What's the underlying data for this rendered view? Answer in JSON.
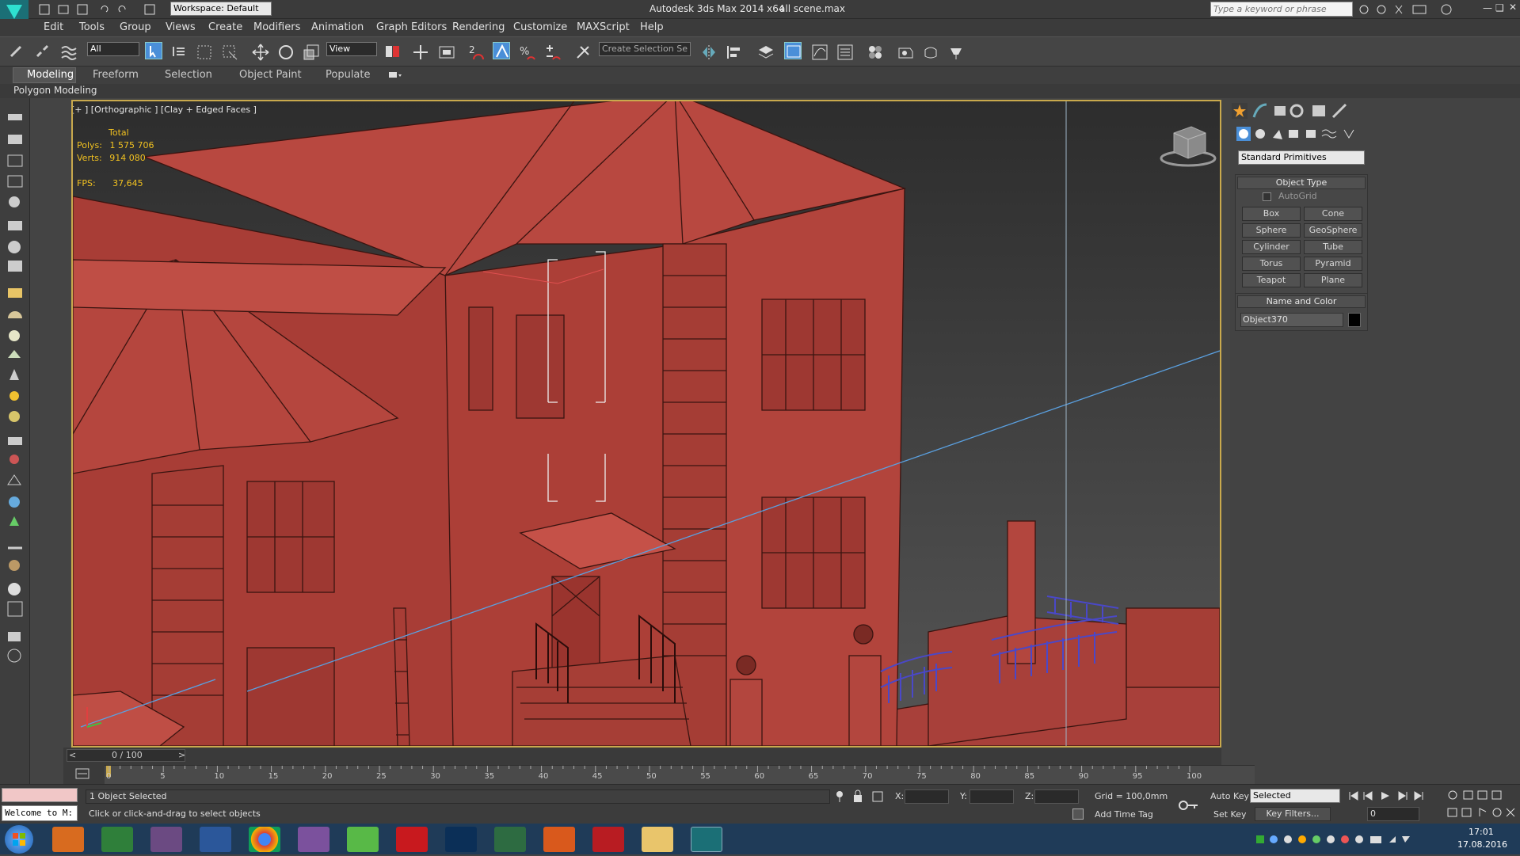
{
  "title_bar": {
    "app_title": "Autodesk 3ds Max  2014 x64",
    "file_name": "all scene.max",
    "workspace": "Workspace: Default",
    "search_placeholder": "Type a keyword or phrase"
  },
  "menu": [
    "Edit",
    "Tools",
    "Group",
    "Views",
    "Create",
    "Modifiers",
    "Animation",
    "Graph Editors",
    "Rendering",
    "Customize",
    "MAXScript",
    "Help"
  ],
  "toolbar": {
    "selection_filter": "All",
    "ref_coord": "View",
    "snap_label": "2",
    "selection_set_placeholder": "Create Selection Se"
  },
  "ribbon_tabs": [
    "Modeling",
    "Freeform",
    "Selection",
    "Object Paint",
    "Populate"
  ],
  "ribbon_sub": "Polygon Modeling",
  "viewport": {
    "label": "[+ ] [Orthographic ] [Clay + Edged Faces ]",
    "stats_header": "Total",
    "polys_label": "Polys:",
    "polys_value": "1 575 706",
    "verts_label": "Verts:",
    "verts_value": "914 080",
    "fps_label": "FPS:",
    "fps_value": "37,645",
    "model_color": "#b2433b",
    "border_color": "#c9a94d"
  },
  "command_panel": {
    "category": "Standard Primitives",
    "object_type_header": "Object Type",
    "autogrid": "AutoGrid",
    "buttons": [
      "Box",
      "Cone",
      "Sphere",
      "GeoSphere",
      "Cylinder",
      "Tube",
      "Torus",
      "Pyramid",
      "Teapot",
      "Plane"
    ],
    "name_color_header": "Name and Color",
    "object_name": "Object370"
  },
  "timeline": {
    "frame_indicator": "0 / 100",
    "ticks": [
      "0",
      "5",
      "10",
      "15",
      "20",
      "25",
      "30",
      "35",
      "40",
      "45",
      "50",
      "55",
      "60",
      "65",
      "70",
      "75",
      "80",
      "85",
      "90",
      "95",
      "100"
    ]
  },
  "status": {
    "maxscript": "Welcome to M:",
    "selected": "1 Object Selected",
    "prompt": "Click or click-and-drag to select objects",
    "x_label": "X:",
    "y_label": "Y:",
    "z_label": "Z:",
    "grid": "Grid = 100,0mm",
    "add_time_tag": "Add Time Tag",
    "auto_key": "Auto Key",
    "set_key": "Set Key",
    "key_mode": "Selected",
    "key_filters": "Key Filters...",
    "frame_value": "0"
  },
  "taskbar": {
    "time": "17:01",
    "date": "17.08.2016"
  }
}
